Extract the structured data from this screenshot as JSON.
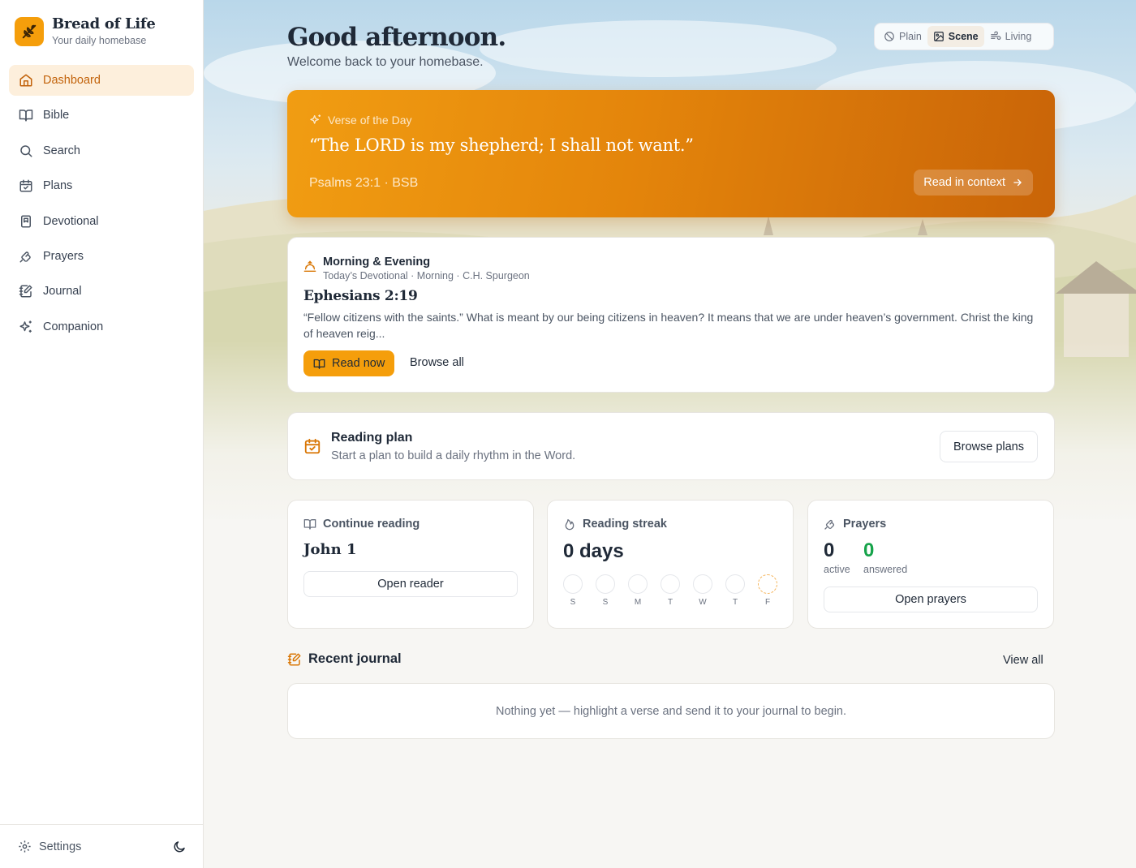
{
  "brand": {
    "name": "Bread of Life",
    "tagline": "Your daily homebase"
  },
  "nav": [
    {
      "label": "Dashboard",
      "icon": "home-icon",
      "active": true
    },
    {
      "label": "Bible",
      "icon": "book-open-icon"
    },
    {
      "label": "Search",
      "icon": "search-icon"
    },
    {
      "label": "Plans",
      "icon": "calendar-check-icon"
    },
    {
      "label": "Devotional",
      "icon": "book-bookmark-icon"
    },
    {
      "label": "Prayers",
      "icon": "praying-hands-icon"
    },
    {
      "label": "Journal",
      "icon": "notebook-pen-icon"
    },
    {
      "label": "Companion",
      "icon": "sparkles-icon"
    }
  ],
  "footer": {
    "settings_label": "Settings",
    "theme_icon": "moon-icon"
  },
  "greeting": {
    "title": "Good afternoon.",
    "subtitle": "Welcome back to your homebase."
  },
  "background_modes": [
    {
      "label": "Plain",
      "icon": "ban-icon"
    },
    {
      "label": "Scene",
      "icon": "image-icon",
      "active": true
    },
    {
      "label": "Living",
      "icon": "wind-icon"
    }
  ],
  "verse": {
    "label": "Verse of the Day",
    "text": "“The LORD is my shepherd; I shall not want.”",
    "reference": "Psalms 23:1 · BSB",
    "button": "Read in context"
  },
  "devotional": {
    "title": "Morning & Evening",
    "meta": "Today’s Devotional · Morning · C.H. Spurgeon",
    "reference": "Ephesians 2:19",
    "excerpt": "“Fellow citizens with the saints.” What is meant by our being citizens in heaven? It means that we are under heaven’s government. Christ the king of heaven reig...",
    "primary_button": "Read now",
    "secondary_button": "Browse all"
  },
  "reading_plan": {
    "title": "Reading plan",
    "subtitle": "Start a plan to build a daily rhythm in the Word.",
    "button": "Browse plans"
  },
  "continue_reading": {
    "title": "Continue reading",
    "reference": "John 1",
    "button": "Open reader"
  },
  "streak": {
    "title": "Reading streak",
    "value": "0 days",
    "days": [
      "S",
      "S",
      "M",
      "T",
      "W",
      "T",
      "F"
    ],
    "today_index": 6
  },
  "prayers": {
    "title": "Prayers",
    "active_count": "0",
    "active_label": "active",
    "answered_count": "0",
    "answered_label": "answered",
    "button": "Open prayers"
  },
  "journal": {
    "title": "Recent journal",
    "view_all": "View all",
    "empty_text": "Nothing yet — highlight a verse and send it to your journal to begin."
  },
  "colors": {
    "accent": "#f59e0b",
    "accent_dark": "#c96408",
    "answered_green": "#16a34a",
    "active_nav_bg": "#fdefdc"
  }
}
